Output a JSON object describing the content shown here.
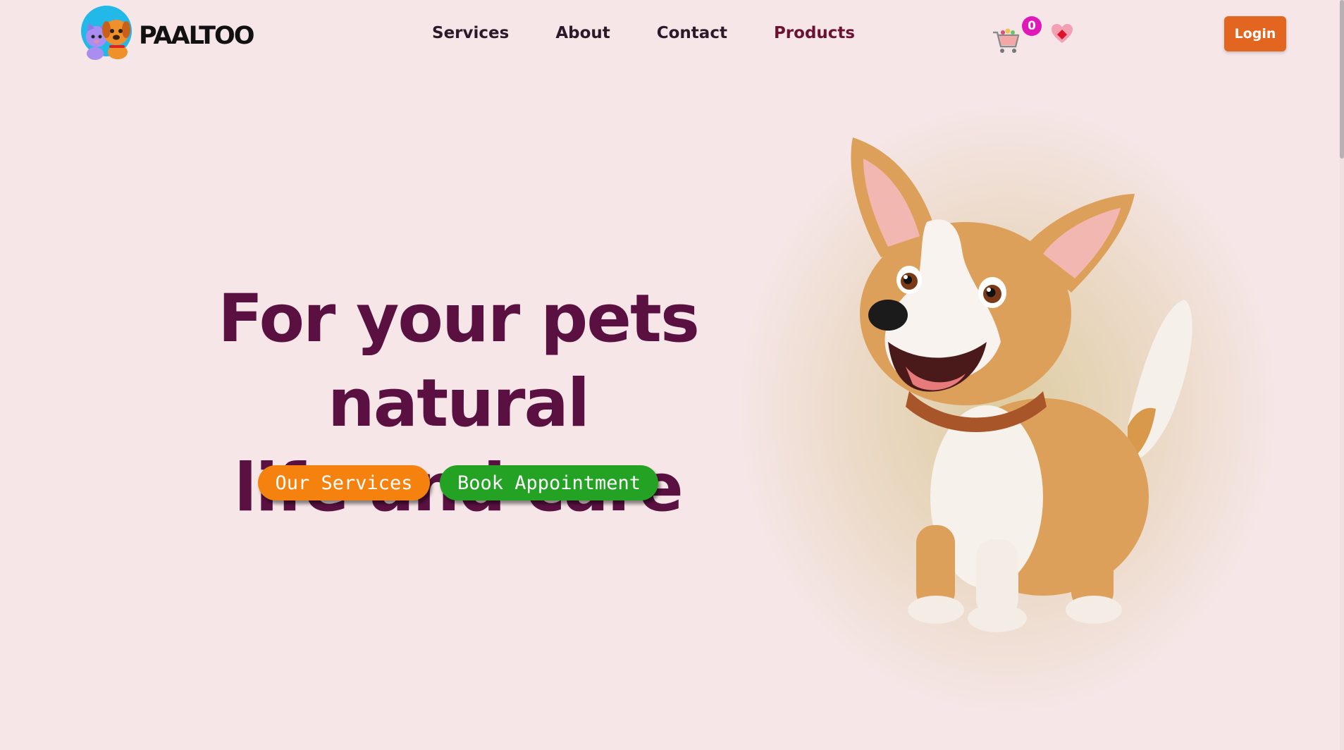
{
  "brand": {
    "name": "PAALTOO",
    "logo_icon": "cat-and-dog-logo-icon"
  },
  "nav": {
    "links": [
      {
        "label": "Services"
      },
      {
        "label": "About"
      },
      {
        "label": "Contact"
      },
      {
        "label": "Products"
      }
    ],
    "cart_icon": "shopping-cart-icon",
    "cart_count": "0",
    "wishlist_icon": "heart-icon",
    "login_label": "Login"
  },
  "hero": {
    "title_line1": "For your pets natural",
    "title_line2": "life and care",
    "services_button": "Our Services",
    "appointment_button": "Book Appointment",
    "image": "cartoon-dog-illustration"
  },
  "colors": {
    "background": "#f6e6e7",
    "title": "#5a1142",
    "login": "#e2661f",
    "services_button": "#f5820f",
    "appointment_button": "#23a224",
    "badge": "#e018b8"
  }
}
